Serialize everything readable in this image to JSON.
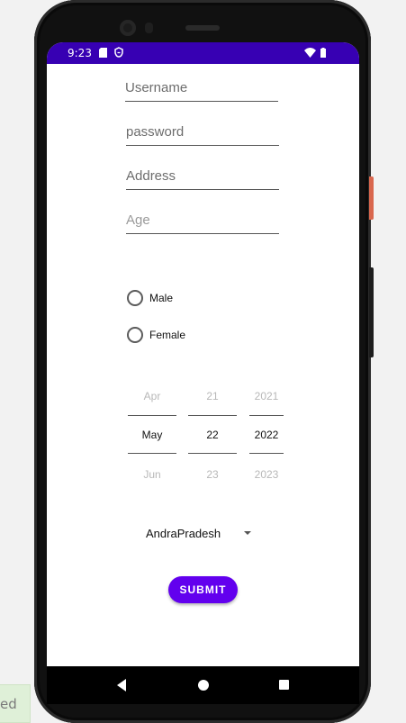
{
  "desktop": {
    "toast_text": "ed"
  },
  "statusbar": {
    "time": "9:23",
    "background": "#3700b3"
  },
  "form": {
    "username_placeholder": "Username",
    "password_placeholder": "password",
    "address_placeholder": "Address",
    "age_placeholder": "Age",
    "gender_options": [
      "Male",
      "Female"
    ],
    "date_picker": {
      "month": {
        "prev": "Apr",
        "selected": "May",
        "next": "Jun"
      },
      "day": {
        "prev": "21",
        "selected": "22",
        "next": "23"
      },
      "year": {
        "prev": "2021",
        "selected": "2022",
        "next": "2023"
      }
    },
    "state_spinner_value": "AndraPradesh",
    "submit_label": "SUBMIT",
    "accent": "#6200ee"
  },
  "icons": [
    "sim-card-icon",
    "shield-icon",
    "wifi-icon",
    "battery-icon",
    "back-icon",
    "home-icon",
    "recent-apps-icon",
    "dropdown-caret-icon"
  ]
}
